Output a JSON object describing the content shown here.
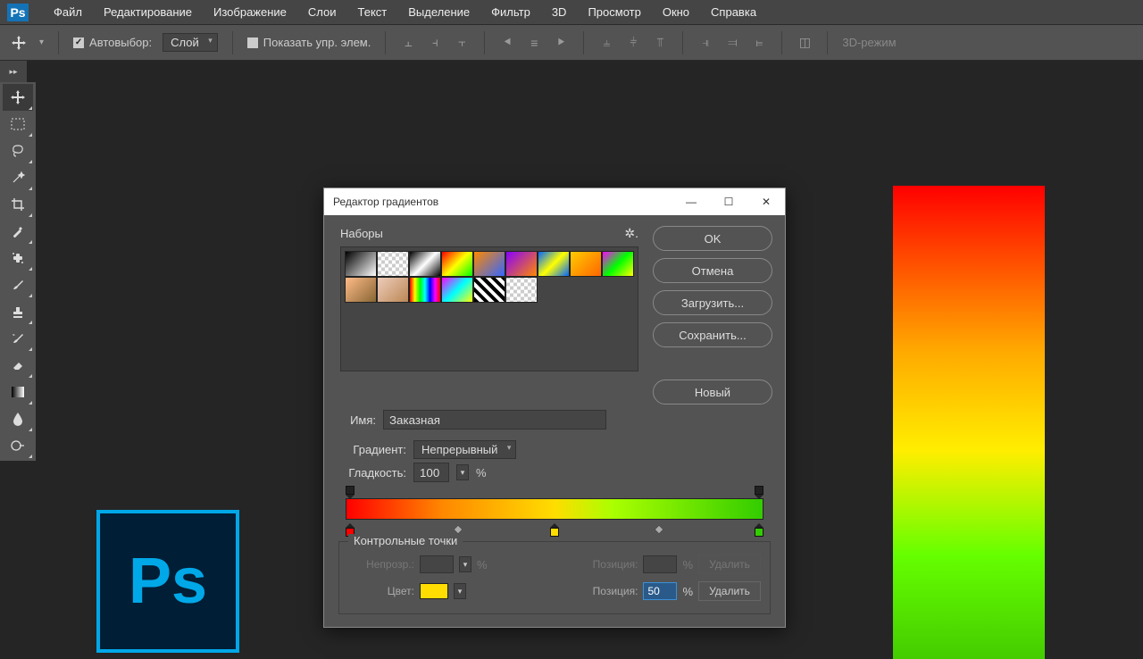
{
  "menubar": {
    "items": [
      "Файл",
      "Редактирование",
      "Изображение",
      "Слои",
      "Текст",
      "Выделение",
      "Фильтр",
      "3D",
      "Просмотр",
      "Окно",
      "Справка"
    ]
  },
  "optbar": {
    "autoselect_label": "Автовыбор:",
    "autoselect_target": "Слой",
    "show_controls_label": "Показать упр. элем.",
    "mode_3d": "3D-режим"
  },
  "dialog": {
    "title": "Редактор градиентов",
    "presets_label": "Наборы",
    "buttons": {
      "ok": "OK",
      "cancel": "Отмена",
      "load": "Загрузить...",
      "save": "Сохранить...",
      "new": "Новый"
    },
    "name_label": "Имя:",
    "name_value": "Заказная",
    "type_label": "Градиент:",
    "type_value": "Непрерывный",
    "smooth_label": "Гладкость:",
    "smooth_value": "100",
    "pct": "%",
    "ctrl_title": "Контрольные точки",
    "opacity_label": "Непрозр.:",
    "position_label": "Позиция:",
    "position_value": "50",
    "color_label": "Цвет:",
    "delete_label": "Удалить"
  },
  "badge": "Ps"
}
